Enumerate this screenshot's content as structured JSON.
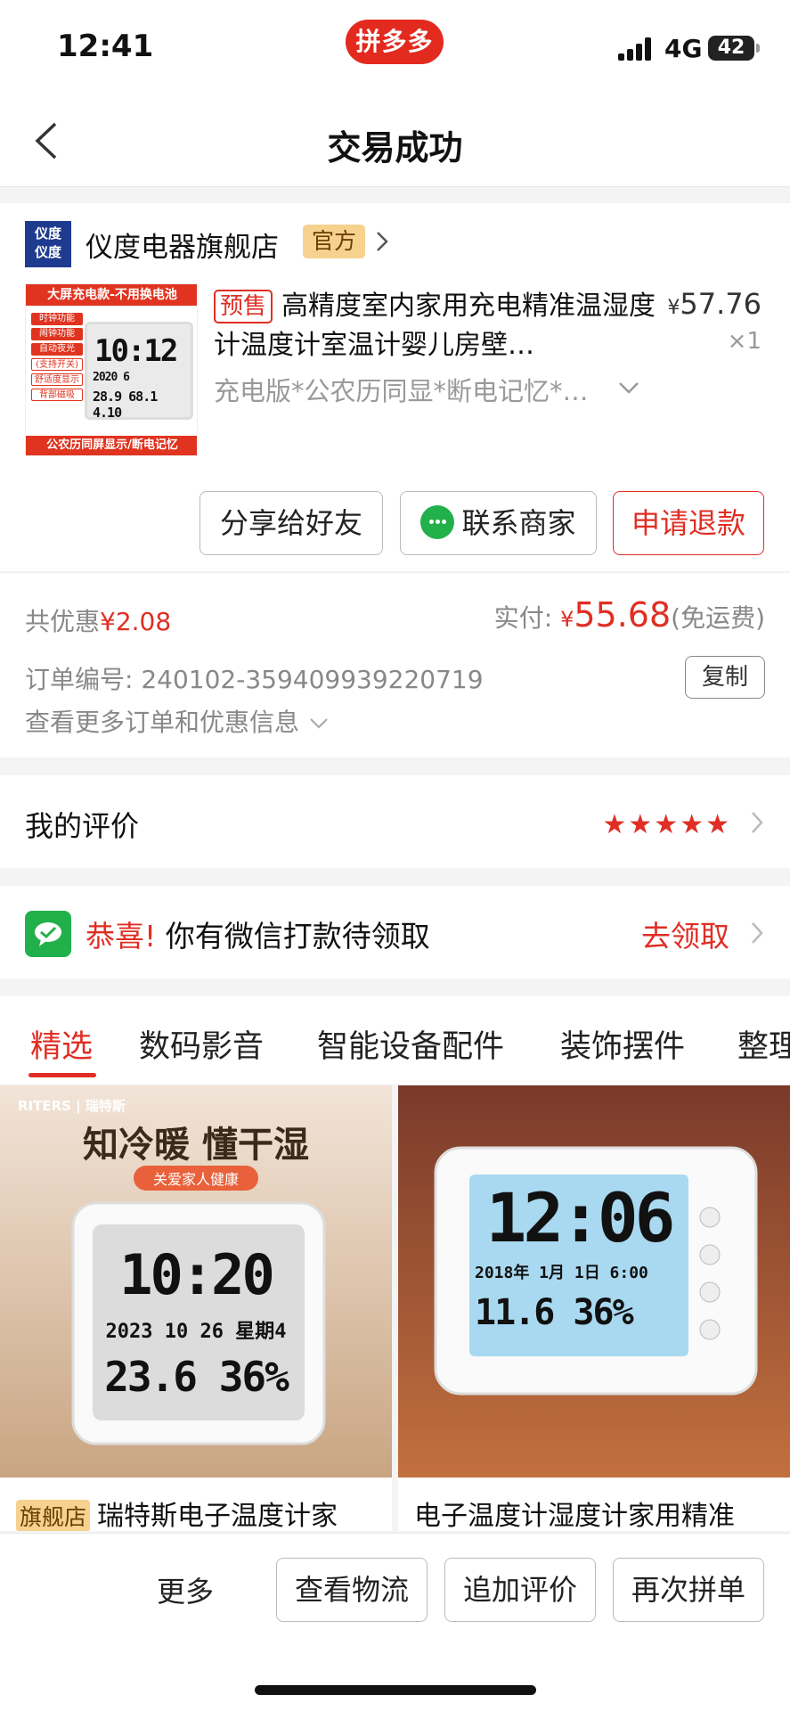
{
  "status": {
    "time": "12:41",
    "app_badge": "拼多多",
    "network": "4G",
    "battery": "42"
  },
  "nav": {
    "title": "交易成功"
  },
  "store": {
    "logo_text": "仪度\n仪度",
    "name": "仪度电器旗舰店",
    "tag": "官方"
  },
  "product": {
    "image_banner_top": "大屏充电款-不用换电池",
    "image_banner_bottom": "公农历同屏显示/断电记忆",
    "image_labels": [
      "时钟功能",
      "闹钟功能",
      "自动夜光",
      "(支持开关)",
      "舒适度显示",
      "背部磁吸"
    ],
    "image_time": "10:12",
    "image_date": "2020 6",
    "image_readings": "28.9 68.1 4.10",
    "presale_tag": "预售",
    "title": "高精度室内家用充电精准温湿度计温度计室温计婴儿房壁…",
    "price_symbol": "¥",
    "price": "57.76",
    "qty": "×1",
    "spec": "充电版*公农历同显*断电记忆*…"
  },
  "actions": {
    "share": "分享给好友",
    "contact": "联系商家",
    "refund": "申请退款"
  },
  "order": {
    "discount_label": "共优惠",
    "discount_value": "¥2.08",
    "paid_label": "实付:",
    "paid_symbol": "¥",
    "paid_value": "55.68",
    "shipping": "(免运费)",
    "order_no": "订单编号: 240102-359409939220719",
    "copy": "复制",
    "more_info": "查看更多订单和优惠信息"
  },
  "review": {
    "label": "我的评价",
    "stars": 5
  },
  "wechat_pay": {
    "congrats": "恭喜!",
    "text": "你有微信打款待领取",
    "action": "去领取"
  },
  "tabs": [
    "精选",
    "数码影音",
    "智能设备配件",
    "装饰摆件",
    "整理"
  ],
  "recommendations": [
    {
      "flag": "旗舰店",
      "name": "瑞特斯电子温度计家",
      "brand": "RITERS | 瑞特斯",
      "headline": "知冷暖 懂干湿",
      "sub": "关爱家人健康",
      "screen_time": "10:20",
      "screen_date": "2023 10 26 星期4",
      "screen_temp": "23.6",
      "screen_hum": "36%"
    },
    {
      "flag": "",
      "name": "电子温度计湿度计家用精准",
      "screen_time": "12:06",
      "screen_date": "2018年 1月 1日 6:00",
      "screen_temp": "11.6",
      "screen_hum": "36%"
    }
  ],
  "bottom": {
    "more": "更多",
    "logistics": "查看物流",
    "add_review": "追加评价",
    "reorder": "再次拼单"
  },
  "colors": {
    "accent": "#e02e24",
    "wechat": "#22b04b",
    "tag_bg": "#f6d28e"
  }
}
